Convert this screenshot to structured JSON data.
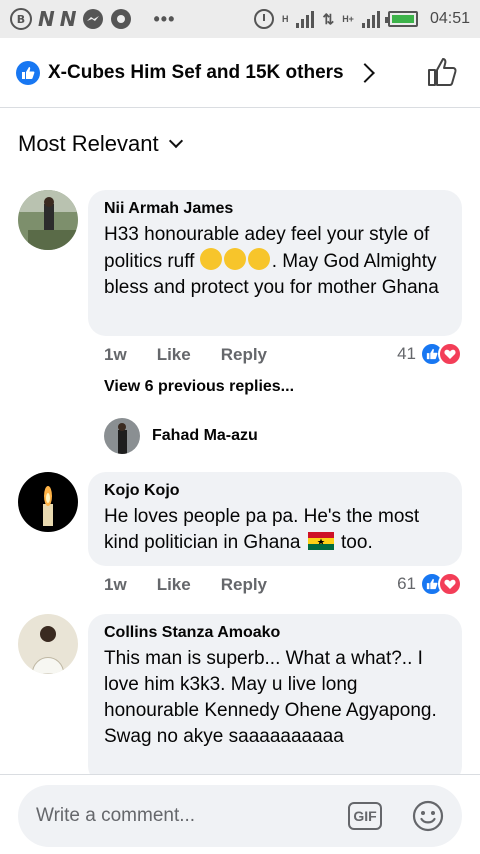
{
  "status_bar": {
    "time": "04:51",
    "network_1": "H",
    "network_2": "H+",
    "icons": [
      "b-icon",
      "n-icon",
      "n-icon",
      "messenger-icon",
      "chrome-icon",
      "more-dots-icon",
      "alarm-icon",
      "signal-icon",
      "battery-icon"
    ]
  },
  "header": {
    "reactions_text": "X-Cubes Him Sef and 15K others"
  },
  "sort": {
    "label": "Most Relevant"
  },
  "comments": [
    {
      "author": "Nii Armah James",
      "text_before": "H33 honourable adey feel your style of politics ruff",
      "emojis": [
        "grinning-face-emoji",
        "grinning-face-emoji",
        "grinning-face-emoji"
      ],
      "text_after": ". May God Almighty bless and protect you for mother Ghana",
      "time": "1w",
      "like": "Like",
      "reply": "Reply",
      "reactions": "41"
    },
    {
      "author": "Kojo Kojo",
      "text_before": "He loves people pa pa. He's the most kind politician in Ghana",
      "flag": "ghana-flag-emoji",
      "text_after": " too.",
      "time": "1w",
      "like": "Like",
      "reply": "Reply",
      "reactions": "61"
    },
    {
      "author": "Collins Stanza Amoako",
      "text": "This man is superb... What a what?.. I love him k3k3. May u live long honourable Kennedy Ohene Agyapong. Swag no akye saaaaaaaaaa"
    }
  ],
  "replies": {
    "view_previous": "View 6 previous replies...",
    "reply_author": "Fahad Ma-azu"
  },
  "composer": {
    "placeholder": "Write a comment...",
    "gif_label": "GIF"
  },
  "colors": {
    "brand_blue": "#1877f2",
    "love_red": "#f33e58",
    "bubble_bg": "#f0f2f5",
    "muted_text": "#65676b"
  }
}
